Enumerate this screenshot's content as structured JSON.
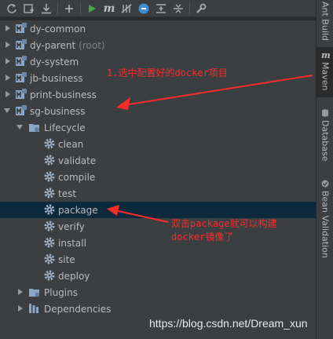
{
  "toolbar": {
    "buttons": [
      {
        "name": "refresh-icon"
      },
      {
        "name": "add-project-icon"
      },
      {
        "name": "download-icon"
      },
      {
        "name": "plus-icon"
      },
      {
        "name": "run-icon"
      },
      {
        "name": "maven-goal-icon",
        "text": "m"
      },
      {
        "name": "toggle-offline-icon"
      },
      {
        "name": "skip-tests-icon"
      },
      {
        "name": "show-dependencies-icon"
      },
      {
        "name": "collapse-all-icon"
      },
      {
        "name": "settings-wrench-icon"
      }
    ]
  },
  "tree": {
    "projects": [
      {
        "label": "dy-common",
        "suffix": ""
      },
      {
        "label": "dy-parent",
        "suffix": "(root)"
      },
      {
        "label": "dy-system",
        "suffix": ""
      },
      {
        "label": "jb-business",
        "suffix": ""
      },
      {
        "label": "print-business",
        "suffix": ""
      },
      {
        "label": "sg-business",
        "suffix": ""
      }
    ],
    "lifecycle_label": "Lifecycle",
    "goals": [
      "clean",
      "validate",
      "compile",
      "test",
      "package",
      "verify",
      "install",
      "site",
      "deploy"
    ],
    "plugins_label": "Plugins",
    "dependencies_label": "Dependencies"
  },
  "sidebar": {
    "tabs": [
      {
        "label": "Ant Build"
      },
      {
        "label": "Maven"
      },
      {
        "label": "Database"
      },
      {
        "label": "Bean Validation"
      }
    ]
  },
  "annotations": {
    "note1": "1.选中配置好的docker项目",
    "note2_line1": "双击package就可以构建",
    "note2_line2": "docker镜像了",
    "arrow_color": "#ff2a2a"
  },
  "watermark": "https://blog.csdn.net/Dream_xun"
}
